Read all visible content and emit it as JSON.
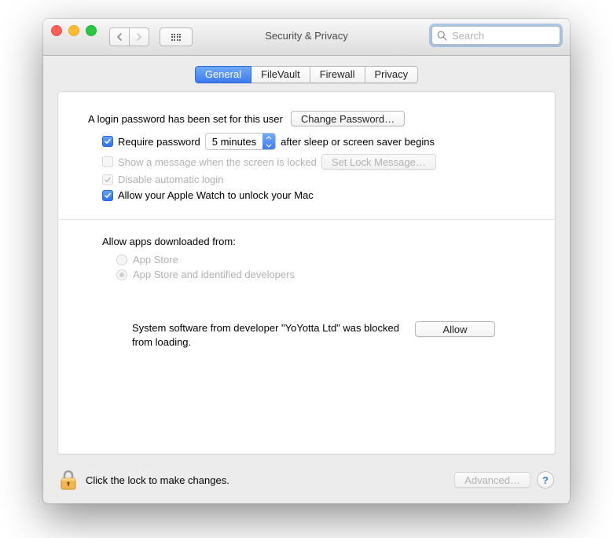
{
  "window": {
    "title": "Security & Privacy"
  },
  "search": {
    "placeholder": "Search"
  },
  "tabs": {
    "general": "General",
    "filevault": "FileVault",
    "firewall": "Firewall",
    "privacy": "Privacy"
  },
  "login": {
    "set_text": "A login password has been set for this user",
    "change_btn": "Change Password…",
    "require_pre": "Require password",
    "require_delay": "5 minutes",
    "require_post": "after sleep or screen saver begins",
    "show_msg": "Show a message when the screen is locked",
    "set_lock_btn": "Set Lock Message…",
    "disable_auto": "Disable automatic login",
    "watch": "Allow your Apple Watch to unlock your Mac"
  },
  "download": {
    "label": "Allow apps downloaded from:",
    "opt1": "App Store",
    "opt2": "App Store and identified developers"
  },
  "blocked": {
    "text": "System software from developer \"YoYotta Ltd\" was blocked from loading.",
    "allow_btn": "Allow"
  },
  "footer": {
    "lock_text": "Click the lock to make changes.",
    "advanced_btn": "Advanced…",
    "help": "?"
  }
}
